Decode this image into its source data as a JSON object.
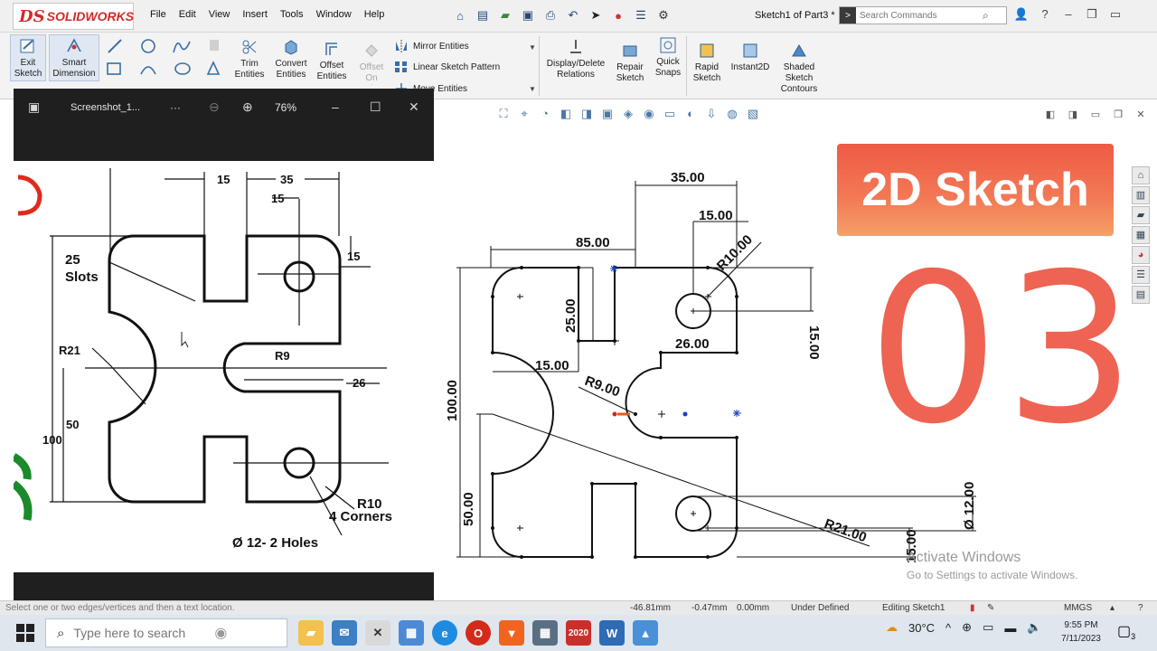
{
  "app": {
    "logo_ds": "DS",
    "logo_text": "SOLIDWORKS",
    "menus": [
      "File",
      "Edit",
      "View",
      "Insert",
      "Tools",
      "Window",
      "Help"
    ],
    "doc_title": "Sketch1 of Part3 *",
    "search_placeholder": "Search Commands"
  },
  "toolbar": {
    "exit_sketch": "Exit Sketch",
    "smart_dimension": "Smart Dimension",
    "trim_entities": "Trim Entities",
    "convert_entities": "Convert Entities",
    "offset_entities": "Offset Entities",
    "offset_on_surface": "Offset On Surface",
    "mirror_entities": "Mirror Entities",
    "linear_sketch_pattern": "Linear Sketch Pattern",
    "move_entities": "Move Entities",
    "display_delete_relations": "Display/Delete Relations",
    "repair_sketch": "Repair Sketch",
    "quick_snaps": "Quick Snaps",
    "rapid_sketch": "Rapid Sketch",
    "instant2d": "Instant2D",
    "shaded_sketch_contours": "Shaded Sketch Contours"
  },
  "viewer": {
    "title": "Screenshot_1...",
    "more": "···",
    "zoom": "76%"
  },
  "reference": {
    "dims": {
      "d15a": "15",
      "d35": "35",
      "d15b": "15",
      "d15c": "15",
      "slots_n": "25",
      "slots_word": "Slots",
      "r21": "R21",
      "r9": "R9",
      "d26": "26",
      "d50": "50",
      "d100": "100",
      "r10": "R10",
      "corners": "4 Corners",
      "holes": "Ø 12- 2 Holes"
    }
  },
  "sketch": {
    "dims": {
      "d35": "35.00",
      "d15a": "15.00",
      "r10": "R10.00",
      "d85": "85.00",
      "d25": "25.00",
      "d15b": "15.00",
      "d26": "26.00",
      "d15c": "15.00",
      "r9": "R9.00",
      "d100": "100.00",
      "d50": "50.00",
      "r21": "R21.00",
      "dia12": "Ø 12.00",
      "d15d": "15.00"
    }
  },
  "overlay": {
    "banner": "2D Sketch",
    "number": "03"
  },
  "watermark": {
    "line1": "Activate Windows",
    "line2": "Go to Settings to activate Windows."
  },
  "status": {
    "hint": "Select one or two edges/vertices and then a text location.",
    "x": "-46.81mm",
    "y": "-0.47mm",
    "z": "0.00mm",
    "state": "Under Defined",
    "editing": "Editing Sketch1",
    "units": "MMGS"
  },
  "taskbar": {
    "search_placeholder": "Type here to search",
    "weather": "30°C",
    "time": "9:55 PM",
    "date": "7/11/2023",
    "notifications": "3",
    "sw_badge": "2020"
  },
  "colors": {
    "banner_top": "#ef5a45",
    "number": "#ee6352",
    "sw_red": "#d42a2a"
  }
}
